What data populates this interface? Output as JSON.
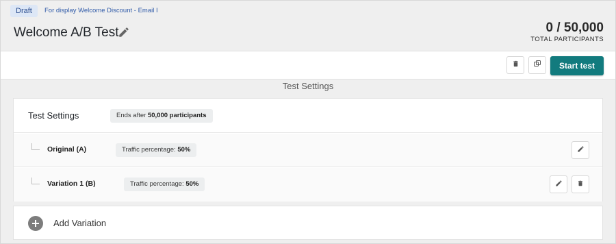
{
  "header": {
    "status_badge": "Draft",
    "subtitle": "For display Welcome Discount - Email I",
    "title": "Welcome A/B Test",
    "participants_count": "0 / 50,000",
    "participants_label": "TOTAL PARTICIPANTS"
  },
  "toolbar": {
    "start_label": "Start test",
    "accent_color": "#127b7e"
  },
  "section_heading": "Test Settings",
  "settings": {
    "title": "Test Settings",
    "ends_prefix": "Ends after ",
    "ends_value": "50,000 participants"
  },
  "variations": [
    {
      "label": "Original (A)",
      "traffic_prefix": "Traffic percentage: ",
      "traffic_value": "50%"
    },
    {
      "label": "Variation 1 (B)",
      "traffic_prefix": "Traffic percentage: ",
      "traffic_value": "50%"
    }
  ],
  "add_variation_label": "Add Variation",
  "icons": [
    "pencil-icon",
    "trash-icon",
    "duplicate-icon",
    "plus-icon"
  ]
}
